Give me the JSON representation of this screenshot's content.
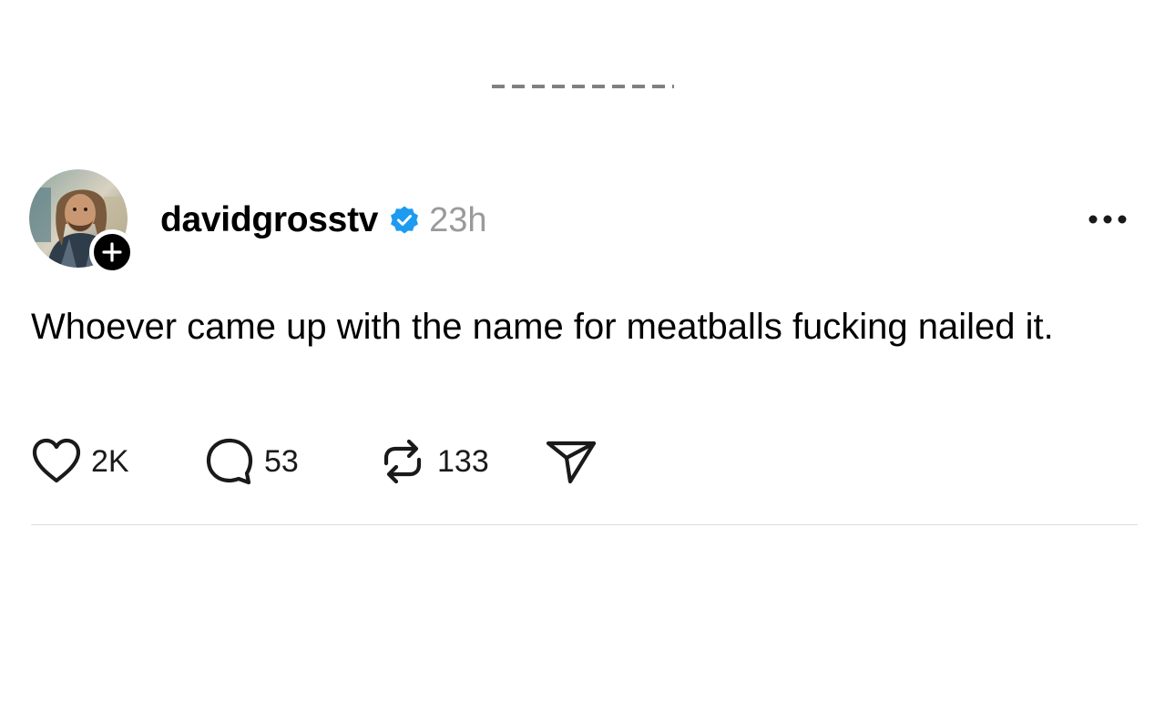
{
  "post": {
    "username": "davidgrosstv",
    "timestamp": "23h",
    "verified": true,
    "text": "Whoever came up with the name for meatballs fucking nailed it.",
    "actions": {
      "likes": "2K",
      "replies": "53",
      "reposts": "133"
    }
  },
  "icons": {
    "follow": "plus-icon",
    "verified": "verified-badge-icon",
    "more": "more-horizontal-icon",
    "like": "heart-icon",
    "reply": "comment-bubble-icon",
    "repost": "repost-icon",
    "share": "send-icon"
  },
  "colors": {
    "text": "#000000",
    "timestamp": "#9a9a9a",
    "verified": "#1d9bf0",
    "divider": "#dedede"
  }
}
